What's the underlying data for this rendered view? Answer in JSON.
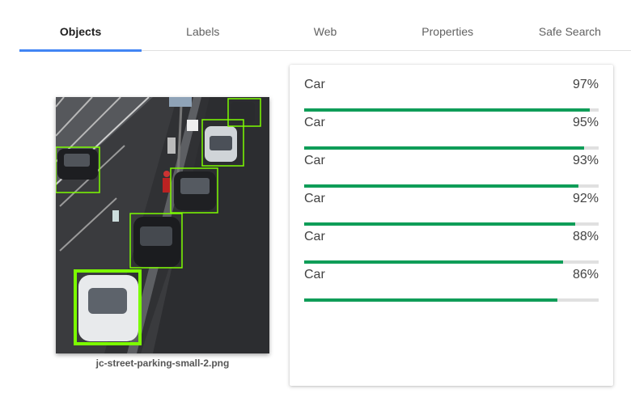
{
  "tabs": [
    {
      "label": "Objects",
      "active": true
    },
    {
      "label": "Labels",
      "active": false
    },
    {
      "label": "Web",
      "active": false
    },
    {
      "label": "Properties",
      "active": false
    },
    {
      "label": "Safe Search",
      "active": false
    }
  ],
  "image": {
    "filename": "jc-street-parking-small-2.png",
    "box_color": "#7cfc00"
  },
  "results": [
    {
      "name": "Car",
      "score_label": "97%",
      "score": 0.97
    },
    {
      "name": "Car",
      "score_label": "95%",
      "score": 0.95
    },
    {
      "name": "Car",
      "score_label": "93%",
      "score": 0.93
    },
    {
      "name": "Car",
      "score_label": "92%",
      "score": 0.92
    },
    {
      "name": "Car",
      "score_label": "88%",
      "score": 0.88
    },
    {
      "name": "Car",
      "score_label": "86%",
      "score": 0.86
    }
  ],
  "colors": {
    "accent": "#4285f4",
    "bar": "#0f9d58",
    "track": "#e0e0e0"
  }
}
